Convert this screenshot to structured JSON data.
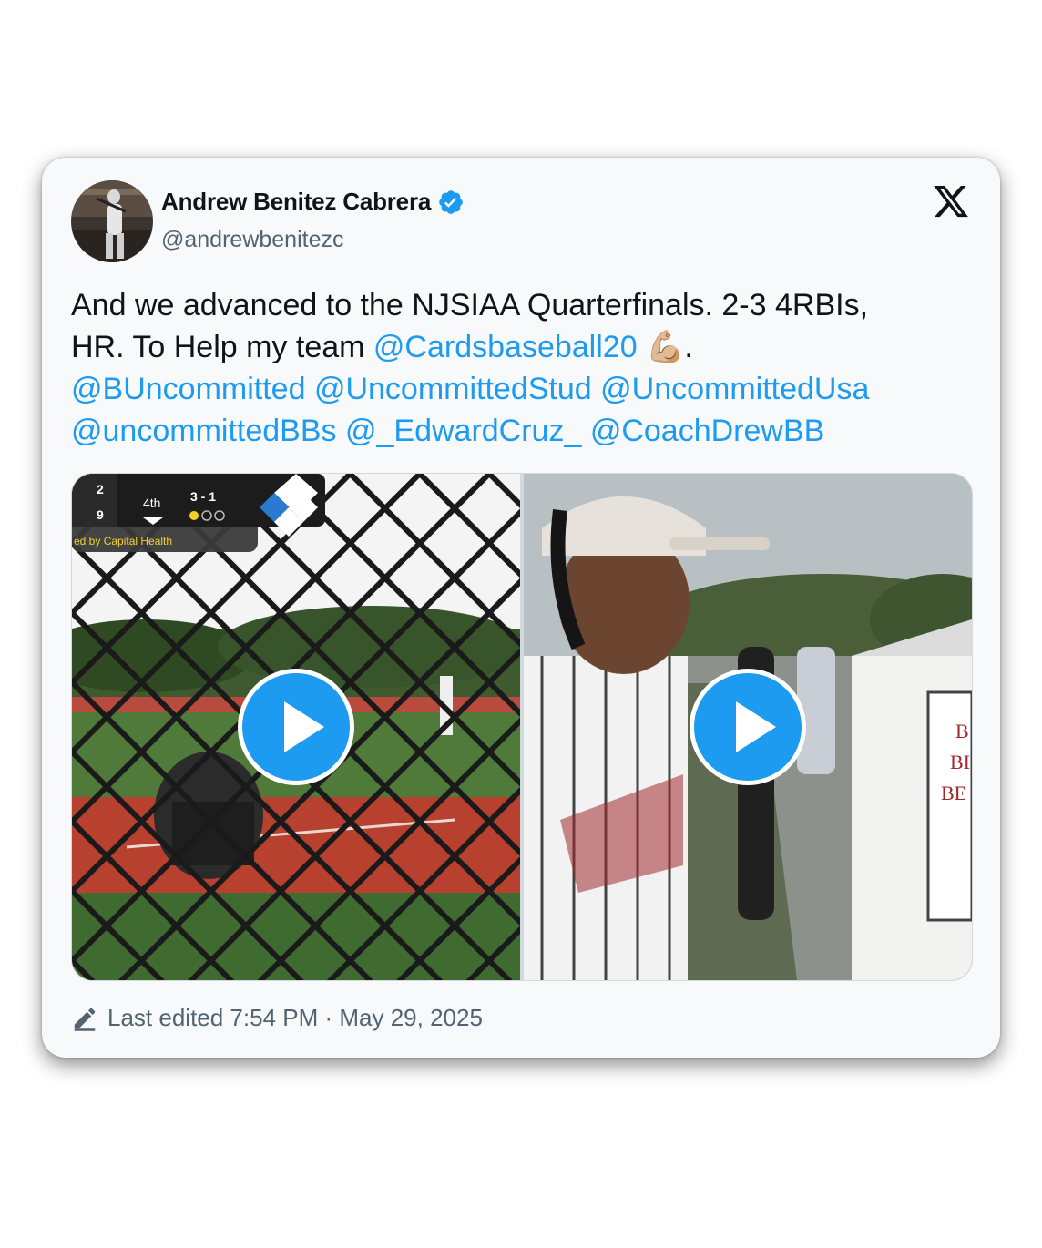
{
  "author": {
    "name": "Andrew Benitez Cabrera",
    "handle": "@andrewbenitezc",
    "verified": true
  },
  "platform_icon": "x-logo-icon",
  "tweet": {
    "line1": "And we advanced to the NJSIAA Quarterfinals.  2-3 4RBIs,",
    "line2_text": "HR. To Help my team ",
    "line2_mention": "@Cardsbaseball20",
    "line2_emoji": "💪🏼",
    "line2_end": ".",
    "mentions_line3": [
      "@BUncommitted",
      "@UncommittedStud",
      "@UncommittedUsa"
    ],
    "mentions_line4": [
      "@uncommittedBBs",
      "@_EdwardCruz_",
      "@CoachDrewBB"
    ]
  },
  "media": {
    "left_video": {
      "scorebug": {
        "away_score": "2",
        "home_score": "9",
        "inning": "4th",
        "count": "3 - 1",
        "sponsor": "ed by Capital Health"
      }
    },
    "right_video": {
      "sign_text": [
        "B",
        "BI",
        "BE"
      ]
    }
  },
  "footer": {
    "edited_label": "Last edited 7:54 PM · May 29, 2025"
  },
  "colors": {
    "link": "#1d9bf0",
    "text": "#0f1419",
    "secondary": "#536471",
    "verified": "#1d9bf0"
  }
}
